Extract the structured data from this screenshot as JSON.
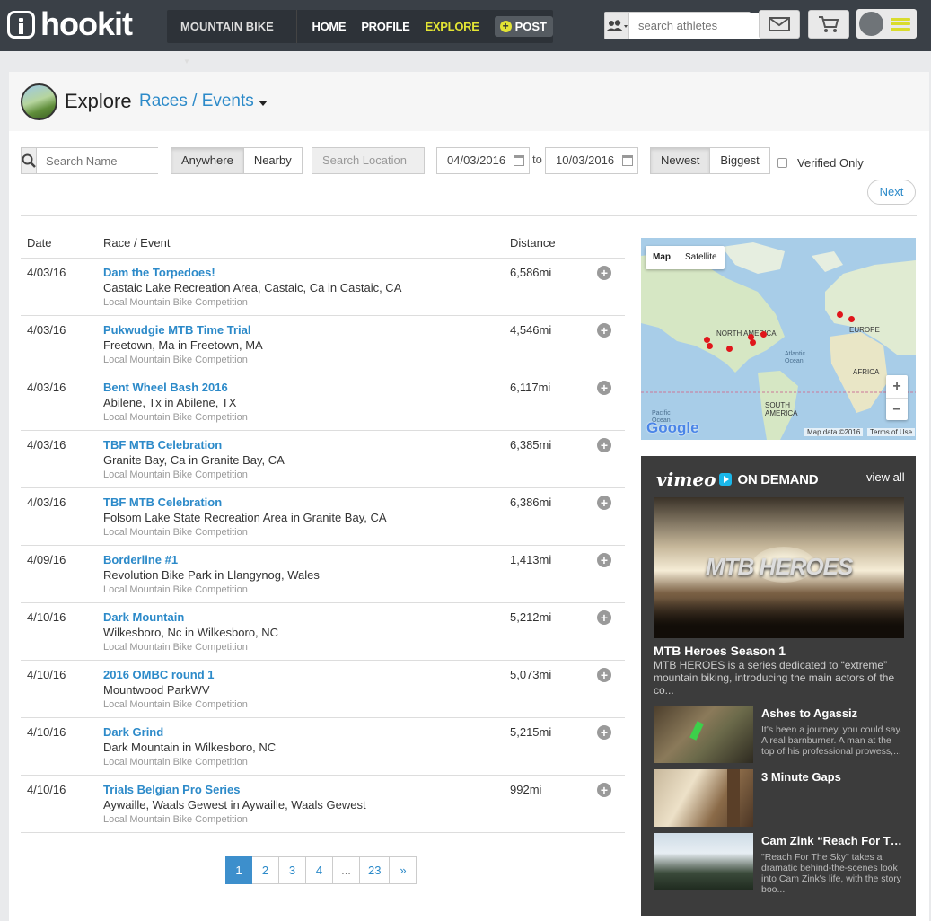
{
  "topbar": {
    "logo_text": "hookit",
    "sport_label": "MOUNTAIN BIKE",
    "nav": [
      "HOME",
      "PROFILE",
      "EXPLORE"
    ],
    "active_nav": "EXPLORE",
    "post_label": "POST",
    "search_placeholder": "search athletes",
    "icons": [
      "people-icon",
      "mail-icon",
      "cart-icon",
      "menu-icon"
    ]
  },
  "header": {
    "title": "Explore",
    "category": "Races / Events"
  },
  "filters": {
    "name_placeholder": "Search Name",
    "location_scope": [
      "Anywhere",
      "Nearby"
    ],
    "location_scope_selected": "Anywhere",
    "location_placeholder": "Search Location",
    "date_from": "04/03/2016",
    "date_to": "10/03/2016",
    "to_label": "to",
    "sort": [
      "Newest",
      "Biggest"
    ],
    "sort_selected": "Newest",
    "verified_label": "Verified Only",
    "verified_checked": false,
    "next_label": "Next"
  },
  "table": {
    "columns": [
      "Date",
      "Race / Event",
      "Distance"
    ],
    "rows": [
      {
        "date": "4/03/16",
        "name": "Dam the Torpedoes!",
        "location": "Castaic Lake Recreation Area, Castaic, Ca in Castaic, CA",
        "type": "Local Mountain Bike Competition",
        "distance": "6,586mi"
      },
      {
        "date": "4/03/16",
        "name": "Pukwudgie MTB Time Trial",
        "location": "Freetown, Ma in Freetown, MA",
        "type": "Local Mountain Bike Competition",
        "distance": "4,546mi"
      },
      {
        "date": "4/03/16",
        "name": "Bent Wheel Bash 2016",
        "location": "Abilene, Tx in Abilene, TX",
        "type": "Local Mountain Bike Competition",
        "distance": "6,117mi"
      },
      {
        "date": "4/03/16",
        "name": "TBF MTB Celebration",
        "location": "Granite Bay, Ca in Granite Bay, CA",
        "type": "Local Mountain Bike Competition",
        "distance": "6,385mi"
      },
      {
        "date": "4/03/16",
        "name": "TBF MTB Celebration",
        "location": "Folsom Lake State Recreation Area in Granite Bay, CA",
        "type": "Local Mountain Bike Competition",
        "distance": "6,386mi"
      },
      {
        "date": "4/09/16",
        "name": "Borderline #1",
        "location": "Revolution Bike Park in Llangynog, Wales",
        "type": "Local Mountain Bike Competition",
        "distance": "1,413mi"
      },
      {
        "date": "4/10/16",
        "name": "Dark Mountain",
        "location": "Wilkesboro, Nc in Wilkesboro, NC",
        "type": "Local Mountain Bike Competition",
        "distance": "5,212mi"
      },
      {
        "date": "4/10/16",
        "name": "2016 OMBC round 1",
        "location": "Mountwood ParkWV",
        "type": "Local Mountain Bike Competition",
        "distance": "5,073mi"
      },
      {
        "date": "4/10/16",
        "name": "Dark Grind",
        "location": "Dark Mountain in Wilkesboro, NC",
        "type": "Local Mountain Bike Competition",
        "distance": "5,215mi"
      },
      {
        "date": "4/10/16",
        "name": "Trials Belgian Pro Series",
        "location": "Aywaille, Waals Gewest in Aywaille, Waals Gewest",
        "type": "Local Mountain Bike Competition",
        "distance": "992mi"
      }
    ]
  },
  "pagination": {
    "pages": [
      "1",
      "2",
      "3",
      "4",
      "...",
      "23",
      "»"
    ],
    "current": "1"
  },
  "map": {
    "types": [
      "Map",
      "Satellite"
    ],
    "active_type": "Map",
    "labels": [
      "NORTH AMERICA",
      "EUROPE",
      "AFRICA",
      "SOUTH AMERICA",
      "Atlantic Ocean",
      "Pacific Ocean"
    ],
    "zoom_in": "+",
    "zoom_out": "−",
    "brand": "Google",
    "credit": "Map data ©2016",
    "terms": "Terms of Use"
  },
  "vimeo": {
    "logo": "vimeo",
    "on_demand": "ON DEMAND",
    "view_all": "view all",
    "feature": {
      "brand_text": "MTB HEROES",
      "title": "MTB Heroes Season 1",
      "description": "MTB HEROES is a series dedicated to “extreme” mountain biking, introducing the main actors of the co..."
    },
    "videos": [
      {
        "title": "Ashes to Agassiz",
        "description": "It's been a journey, you could say. A real barnburner. A man at the top of his professional prowess,..."
      },
      {
        "title": "3 Minute Gaps",
        "description": ""
      },
      {
        "title": "Cam Zink “Reach For The S...",
        "description": "\"Reach For The Sky\" takes a dramatic behind-the-scenes look into Cam Zink's life, with the story boo..."
      }
    ]
  },
  "colors": {
    "topbar": "#3a4047",
    "accent_yellow": "#e2e434",
    "link_blue": "#2c8ac9",
    "vimeo_bg": "#3c3c3c"
  }
}
